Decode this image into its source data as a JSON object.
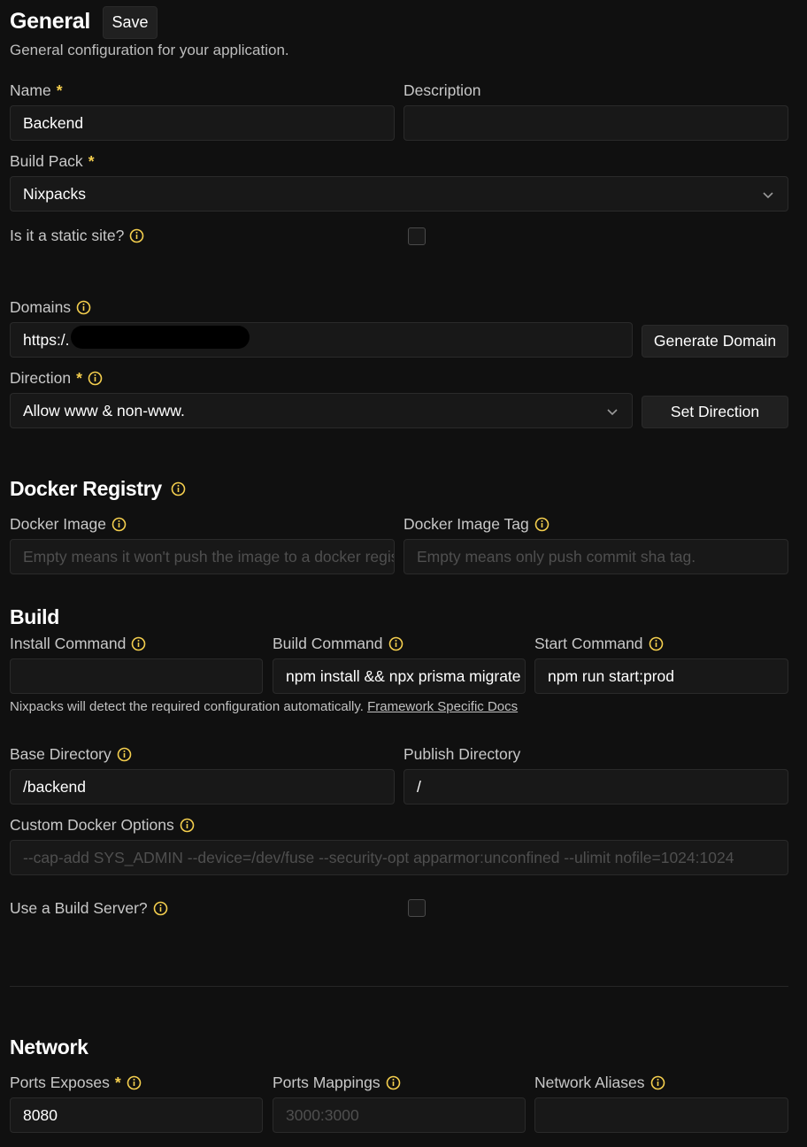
{
  "general": {
    "title": "General",
    "save_label": "Save",
    "subtitle": "General configuration for your application."
  },
  "fields": {
    "name": {
      "label": "Name",
      "value": "Backend",
      "required": "*"
    },
    "description": {
      "label": "Description",
      "value": ""
    },
    "build_pack": {
      "label": "Build Pack",
      "value": "Nixpacks",
      "required": "*"
    },
    "static_site": {
      "label": "Is it a static site?",
      "checked": false
    },
    "domains": {
      "label": "Domains",
      "value": "https:/.",
      "button": "Generate Domain"
    },
    "direction": {
      "label": "Direction",
      "value": "Allow www & non-www.",
      "required": "*",
      "button": "Set Direction"
    }
  },
  "docker_registry": {
    "title": "Docker Registry",
    "image": {
      "label": "Docker Image",
      "placeholder": "Empty means it won't push the image to a docker registry."
    },
    "tag": {
      "label": "Docker Image Tag",
      "placeholder": "Empty means only push commit sha tag."
    }
  },
  "build": {
    "title": "Build",
    "install": {
      "label": "Install Command",
      "value": ""
    },
    "build_cmd": {
      "label": "Build Command",
      "value": "npm install && npx prisma migrate"
    },
    "start": {
      "label": "Start Command",
      "value": "npm run start:prod"
    },
    "hint": "Nixpacks will detect the required configuration automatically.",
    "hint_link": "Framework Specific Docs",
    "base_dir": {
      "label": "Base Directory",
      "value": "/backend"
    },
    "publish_dir": {
      "label": "Publish Directory",
      "value": "/"
    },
    "custom_docker": {
      "label": "Custom Docker Options",
      "placeholder": "--cap-add SYS_ADMIN --device=/dev/fuse --security-opt apparmor:unconfined --ulimit nofile=1024:1024"
    },
    "build_server": {
      "label": "Use a Build Server?",
      "checked": false
    }
  },
  "network": {
    "title": "Network",
    "ports_exposes": {
      "label": "Ports Exposes",
      "value": "8080",
      "required": "*"
    },
    "ports_mappings": {
      "label": "Ports Mappings",
      "placeholder": "3000:3000"
    },
    "network_aliases": {
      "label": "Network Aliases",
      "value": ""
    }
  },
  "colors": {
    "accent": "#f5cf4e",
    "background": "#101010",
    "input_bg": "#181818"
  }
}
